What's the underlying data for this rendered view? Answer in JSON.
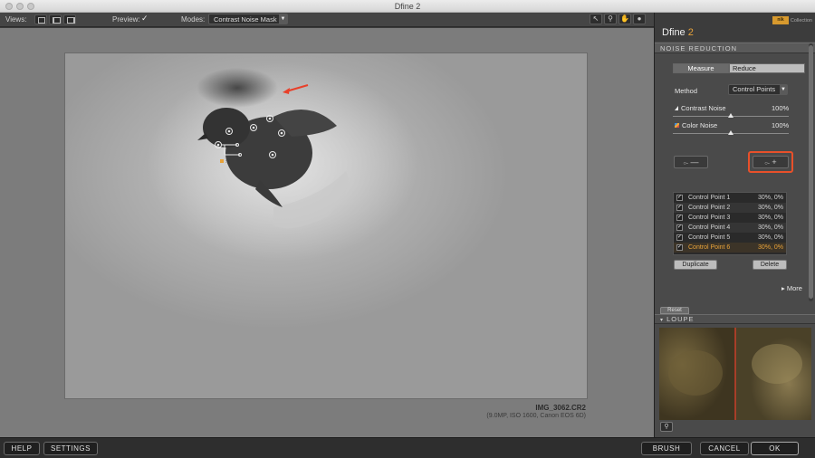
{
  "window": {
    "title": "Dfine 2"
  },
  "toolbar": {
    "views_label": "Views:",
    "preview_label": "Preview:",
    "preview_checked": true,
    "modes_label": "Modes:",
    "modes_value": "Contrast Noise Mask"
  },
  "canvas": {
    "file_name": "IMG_3062.CR2",
    "file_meta": "(9.0MP, ISO 1600, Canon EOS 6D)"
  },
  "panel": {
    "app_name": "Dfine",
    "app_version": "2",
    "brand_logo_text": "nik",
    "brand_collection": "Collection",
    "section_noise": "NOISE REDUCTION",
    "tab_measure": "Measure",
    "tab_reduce": "Reduce",
    "method_label": "Method",
    "method_value": "Control Points",
    "contrast_noise_label": "Contrast Noise",
    "contrast_noise_value": "100%",
    "contrast_noise_level": 1.0,
    "color_noise_label": "Color Noise",
    "color_noise_value": "100%",
    "color_noise_level": 1.0,
    "control_points": [
      {
        "name": "Control Point 1",
        "value": "30%, 0%",
        "checked": true,
        "selected": false
      },
      {
        "name": "Control Point 2",
        "value": "30%, 0%",
        "checked": true,
        "selected": false
      },
      {
        "name": "Control Point 3",
        "value": "30%, 0%",
        "checked": true,
        "selected": false
      },
      {
        "name": "Control Point 4",
        "value": "30%, 0%",
        "checked": true,
        "selected": false
      },
      {
        "name": "Control Point 5",
        "value": "30%, 0%",
        "checked": true,
        "selected": false
      },
      {
        "name": "Control Point 6",
        "value": "30%, 0%",
        "checked": true,
        "selected": true
      }
    ],
    "duplicate_label": "Duplicate",
    "delete_label": "Delete",
    "more_label": "More",
    "reset_label": "Reset",
    "section_loupe": "LOUPE"
  },
  "bottom": {
    "help": "HELP",
    "settings": "SETTINGS",
    "brush": "BRUSH",
    "cancel": "CANCEL",
    "ok": "OK"
  },
  "colors": {
    "accent": "#e8a33a",
    "highlight": "#e8502a"
  }
}
